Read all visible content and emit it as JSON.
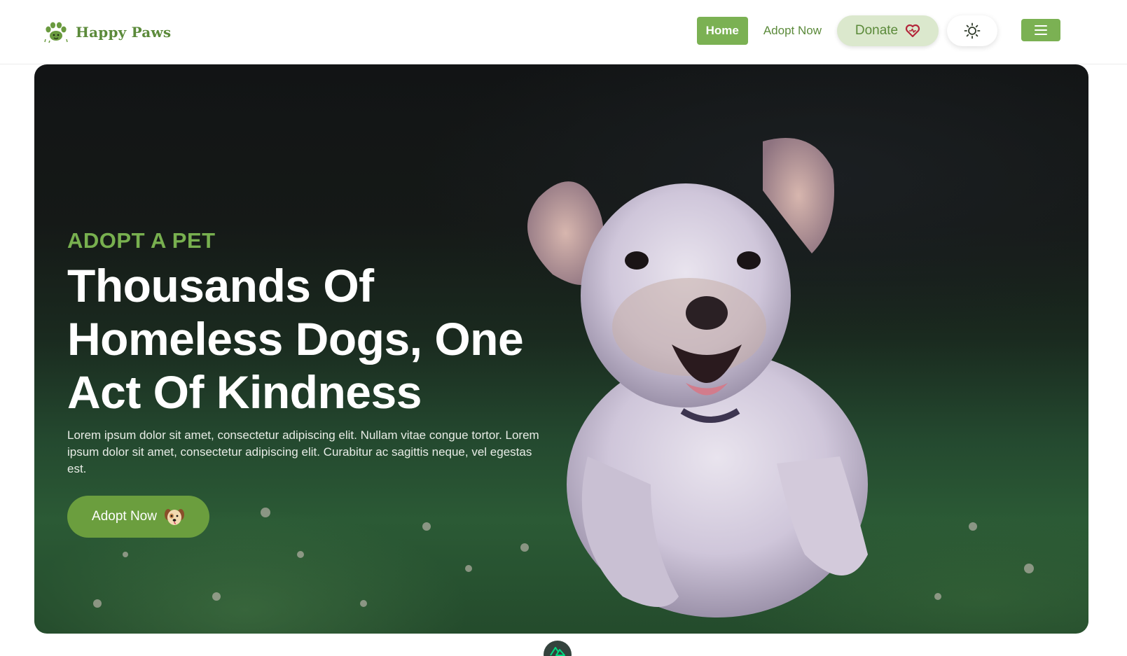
{
  "brand": {
    "name": "Happy Paws",
    "icon": "paw-icon",
    "color": "#5b8a3a"
  },
  "nav": {
    "home_label": "Home",
    "adopt_label": "Adopt Now",
    "donate_label": "Donate",
    "donate_icon": "heart-icon",
    "theme_icon": "sun-icon",
    "menu_icon": "hamburger-icon"
  },
  "hero": {
    "eyebrow": "ADOPT A PET",
    "headline_lines": [
      "Thousands Of",
      "Homeless Dogs, One",
      "Act Of Kindness"
    ],
    "description": "Lorem ipsum dolor sit amet, consectetur adipiscing elit. Nullam vitae congue tortor. Lorem ipsum dolor sit amet, consectetur adipiscing elit. Curabitur ac sagittis neque, vel egestas est.",
    "cta_label": "Adopt Now",
    "cta_icon": "dog-face-icon",
    "image_subject": "dog-photo"
  },
  "footer_badge": {
    "icon": "nuxt-logo-icon"
  },
  "colors": {
    "accent": "#7bb153",
    "accent_dark": "#6b9e3e",
    "eyebrow": "#78b04f",
    "donate_bg": "#dbe8cd",
    "heart": "#b3263a"
  }
}
